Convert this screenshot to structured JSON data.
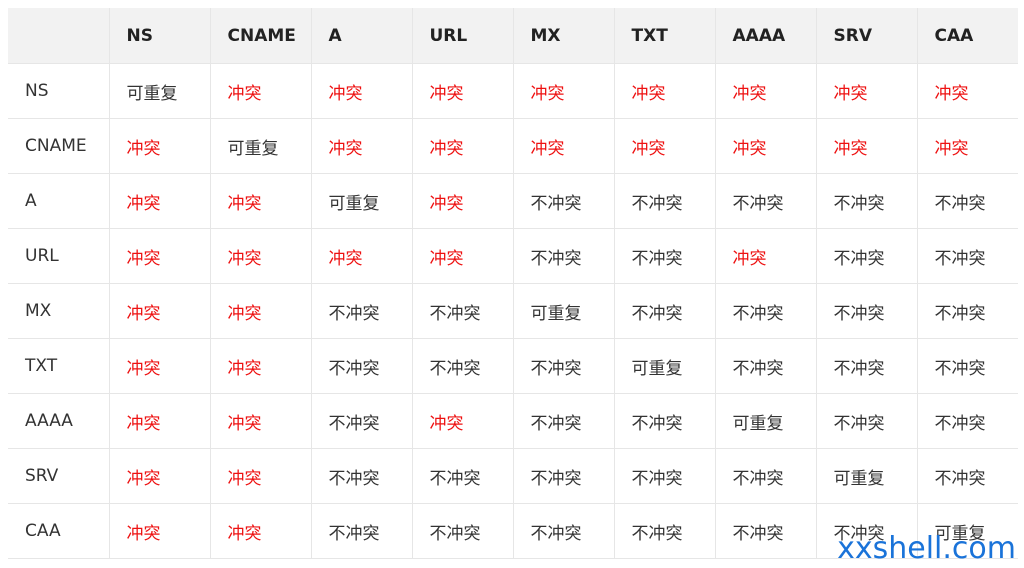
{
  "table": {
    "corner": "",
    "columns": [
      "NS",
      "CNAME",
      "A",
      "URL",
      "MX",
      "TXT",
      "AAAA",
      "SRV",
      "CAA"
    ],
    "rows": [
      {
        "label": "NS",
        "cells": [
          "可重复",
          "冲突",
          "冲突",
          "冲突",
          "冲突",
          "冲突",
          "冲突",
          "冲突",
          "冲突"
        ]
      },
      {
        "label": "CNAME",
        "cells": [
          "冲突",
          "可重复",
          "冲突",
          "冲突",
          "冲突",
          "冲突",
          "冲突",
          "冲突",
          "冲突"
        ]
      },
      {
        "label": "A",
        "cells": [
          "冲突",
          "冲突",
          "可重复",
          "冲突",
          "不冲突",
          "不冲突",
          "不冲突",
          "不冲突",
          "不冲突"
        ]
      },
      {
        "label": "URL",
        "cells": [
          "冲突",
          "冲突",
          "冲突",
          "冲突",
          "不冲突",
          "不冲突",
          "冲突",
          "不冲突",
          "不冲突"
        ]
      },
      {
        "label": "MX",
        "cells": [
          "冲突",
          "冲突",
          "不冲突",
          "不冲突",
          "可重复",
          "不冲突",
          "不冲突",
          "不冲突",
          "不冲突"
        ]
      },
      {
        "label": "TXT",
        "cells": [
          "冲突",
          "冲突",
          "不冲突",
          "不冲突",
          "不冲突",
          "可重复",
          "不冲突",
          "不冲突",
          "不冲突"
        ]
      },
      {
        "label": "AAAA",
        "cells": [
          "冲突",
          "冲突",
          "不冲突",
          "冲突",
          "不冲突",
          "不冲突",
          "可重复",
          "不冲突",
          "不冲突"
        ]
      },
      {
        "label": "SRV",
        "cells": [
          "冲突",
          "冲突",
          "不冲突",
          "不冲突",
          "不冲突",
          "不冲突",
          "不冲突",
          "可重复",
          "不冲突"
        ]
      },
      {
        "label": "CAA",
        "cells": [
          "冲突",
          "冲突",
          "不冲突",
          "不冲突",
          "不冲突",
          "不冲突",
          "不冲突",
          "不冲突",
          "可重复"
        ]
      }
    ]
  },
  "colors": {
    "conflict": "#ee1111",
    "normal_text": "#333333",
    "header_bg": "#f2f2f2",
    "watermark": "#1a73d9"
  },
  "watermark": "xxshell.com"
}
